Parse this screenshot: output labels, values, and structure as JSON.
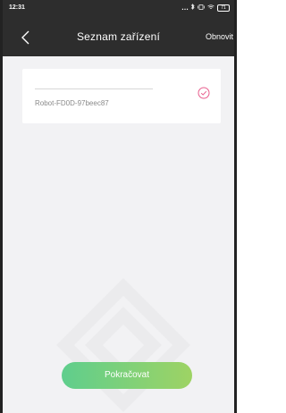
{
  "status_bar": {
    "time": "12:31",
    "icons": [
      "dots-icon",
      "bluetooth-icon",
      "vibrate-icon",
      "wifi-icon",
      "battery-icon"
    ],
    "battery_level": "71"
  },
  "header": {
    "title": "Seznam zařízení",
    "refresh_label": "Obnovit",
    "background_color": "#2d2d2d"
  },
  "device_list": [
    {
      "name": "Robot-FD0D-97beec87",
      "selected": true
    }
  ],
  "actions": {
    "continue_label": "Pokračovat"
  },
  "colors": {
    "accent_pink": "#e85d8d",
    "button_gradient_start": "#5fce8d",
    "button_gradient_end": "#9ed364",
    "content_background": "#f2f2f4"
  }
}
